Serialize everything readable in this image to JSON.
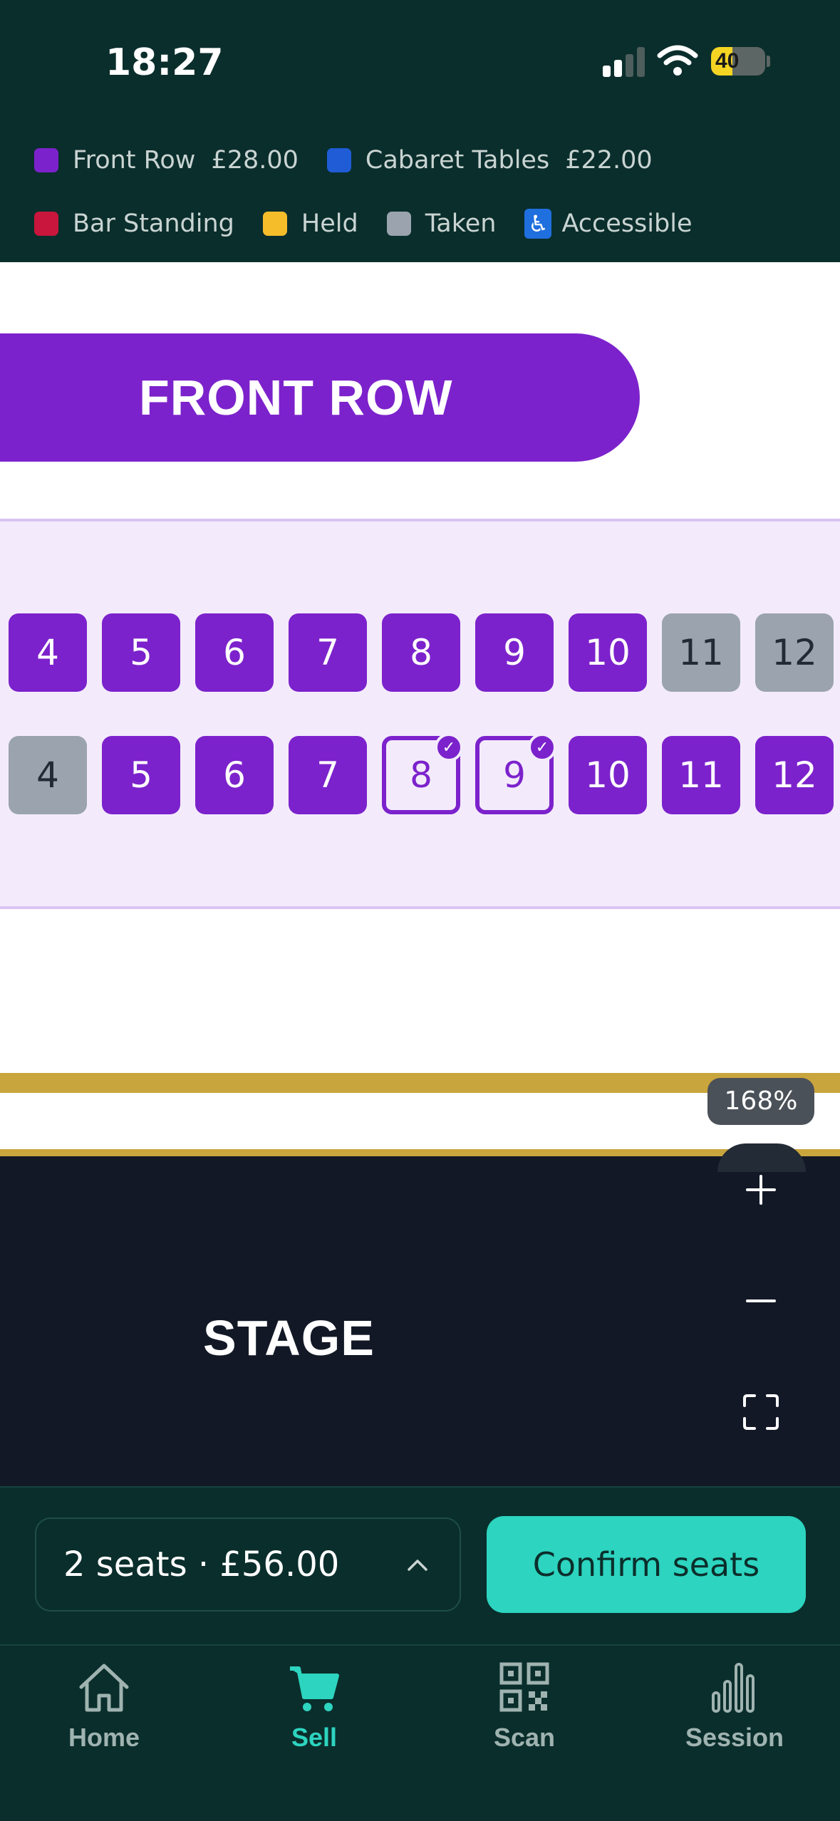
{
  "status_bar": {
    "time": "18:27",
    "battery_level": 40
  },
  "legend": {
    "row1": [
      {
        "label": "Front Row",
        "price": "£28.00",
        "color": "#7c22cc"
      },
      {
        "label": "Cabaret Tables",
        "price": "£22.00",
        "color": "#1f5cd6"
      }
    ],
    "row2": [
      {
        "label": "Bar Standing",
        "color": "#c8163c"
      },
      {
        "label": "Held",
        "color": "#f6bd2b"
      },
      {
        "label": "Taken",
        "color": "#9aa3ae"
      },
      {
        "label": "Accessible",
        "icon": "wheelchair-icon",
        "color": "#1f6fde"
      }
    ]
  },
  "seat_map": {
    "section_title": "FRONT ROW",
    "rows": [
      {
        "seats": [
          {
            "number": "4",
            "state": "available"
          },
          {
            "number": "5",
            "state": "available"
          },
          {
            "number": "6",
            "state": "available"
          },
          {
            "number": "7",
            "state": "available"
          },
          {
            "number": "8",
            "state": "available"
          },
          {
            "number": "9",
            "state": "available"
          },
          {
            "number": "10",
            "state": "available"
          },
          {
            "number": "11",
            "state": "taken"
          },
          {
            "number": "12",
            "state": "taken"
          }
        ]
      },
      {
        "seats": [
          {
            "number": "4",
            "state": "taken"
          },
          {
            "number": "5",
            "state": "available"
          },
          {
            "number": "6",
            "state": "available"
          },
          {
            "number": "7",
            "state": "available"
          },
          {
            "number": "8",
            "state": "selected"
          },
          {
            "number": "9",
            "state": "selected"
          },
          {
            "number": "10",
            "state": "available"
          },
          {
            "number": "11",
            "state": "available"
          },
          {
            "number": "12",
            "state": "available"
          }
        ]
      }
    ],
    "stage_label": "STAGE",
    "zoom_level": "168%"
  },
  "action_bar": {
    "summary": "2 seats · £56.00",
    "confirm_label": "Confirm seats"
  },
  "tabs": [
    {
      "label": "Home",
      "icon": "home-icon",
      "active": false
    },
    {
      "label": "Sell",
      "icon": "cart-icon",
      "active": true
    },
    {
      "label": "Scan",
      "icon": "qr-code-icon",
      "active": false
    },
    {
      "label": "Session",
      "icon": "bar-chart-icon",
      "active": false
    }
  ]
}
